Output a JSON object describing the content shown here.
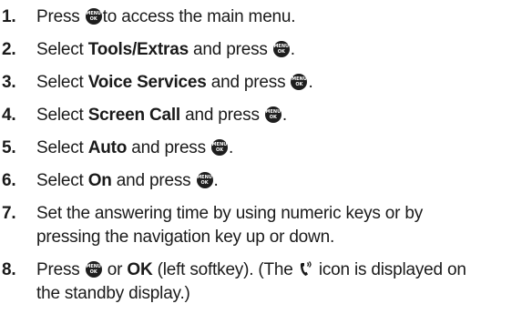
{
  "menu_key": {
    "top": "MENU",
    "bottom": "OK"
  },
  "steps": [
    {
      "num": "1.",
      "t1": "Press",
      "t2": "to access the main menu."
    },
    {
      "num": "2.",
      "t1": "Select",
      "bold": "Tools/Extras",
      "t2": "and press",
      "end": "."
    },
    {
      "num": "3.",
      "t1": "Select",
      "bold": "Voice Services",
      "t2": "and press",
      "end": "."
    },
    {
      "num": "4.",
      "t1": "Select",
      "bold": "Screen Call",
      "t2": "and press",
      "end": "."
    },
    {
      "num": "5.",
      "t1": "Select",
      "bold": "Auto",
      "t2": "and press",
      "end": "."
    },
    {
      "num": "6.",
      "t1": "Select",
      "bold": "On",
      "t2": "and press",
      "end": "."
    },
    {
      "num": "7.",
      "line1": "Set the answering time by using numeric keys or by",
      "line2": "pressing the navigation key up or down."
    },
    {
      "num": "8.",
      "t1": "Press",
      "t2": "or",
      "bold": "OK",
      "t3": "(left softkey). (The",
      "t4": "icon is displayed on",
      "line2": "the standby display.)"
    }
  ]
}
